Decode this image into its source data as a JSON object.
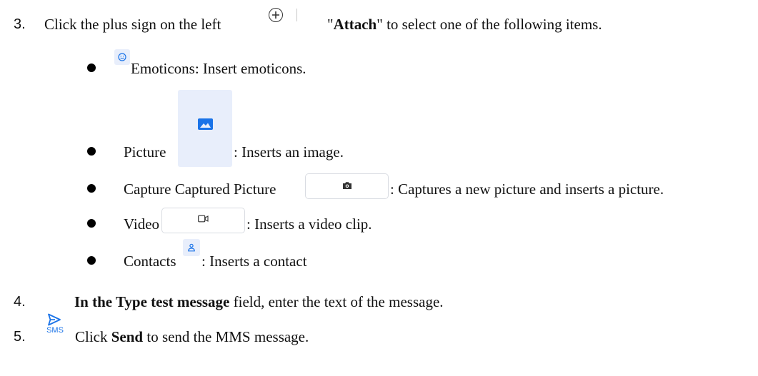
{
  "steps": {
    "step3": {
      "number": "3.",
      "text_before": "Click the plus sign on the left",
      "attach_open": "\"",
      "attach_label": "Attach",
      "attach_close": "\"",
      "text_after": " to select one of the following items."
    },
    "items": [
      {
        "label": "Emoticons: Insert emoticons."
      },
      {
        "label": "Picture",
        "desc": ": Inserts an image."
      },
      {
        "label": "Capture Captured Picture",
        "desc": ": Captures a new picture and inserts a picture."
      },
      {
        "label": "Video",
        "desc": ": Inserts a video clip."
      },
      {
        "label": "Contacts",
        "desc": ": Inserts a contact"
      }
    ],
    "step4": {
      "number": "4.",
      "bold": "In the Type test message",
      "text": " field, enter the text of the message."
    },
    "step5": {
      "number": "5.",
      "sms_icon_label": "SMS",
      "text_before": "Click ",
      "bold": "Send",
      "text_after": " to send the MMS message."
    }
  },
  "icons": {
    "attach": "plus-circle-icon",
    "emoticon": "smiley-icon",
    "picture": "image-icon",
    "camera": "camera-icon",
    "video": "video-camera-icon",
    "contact": "person-icon",
    "send": "send-icon"
  },
  "colors": {
    "icon_blue": "#1a73e8",
    "tile_light": "#e8eefb",
    "text": "#111111"
  }
}
